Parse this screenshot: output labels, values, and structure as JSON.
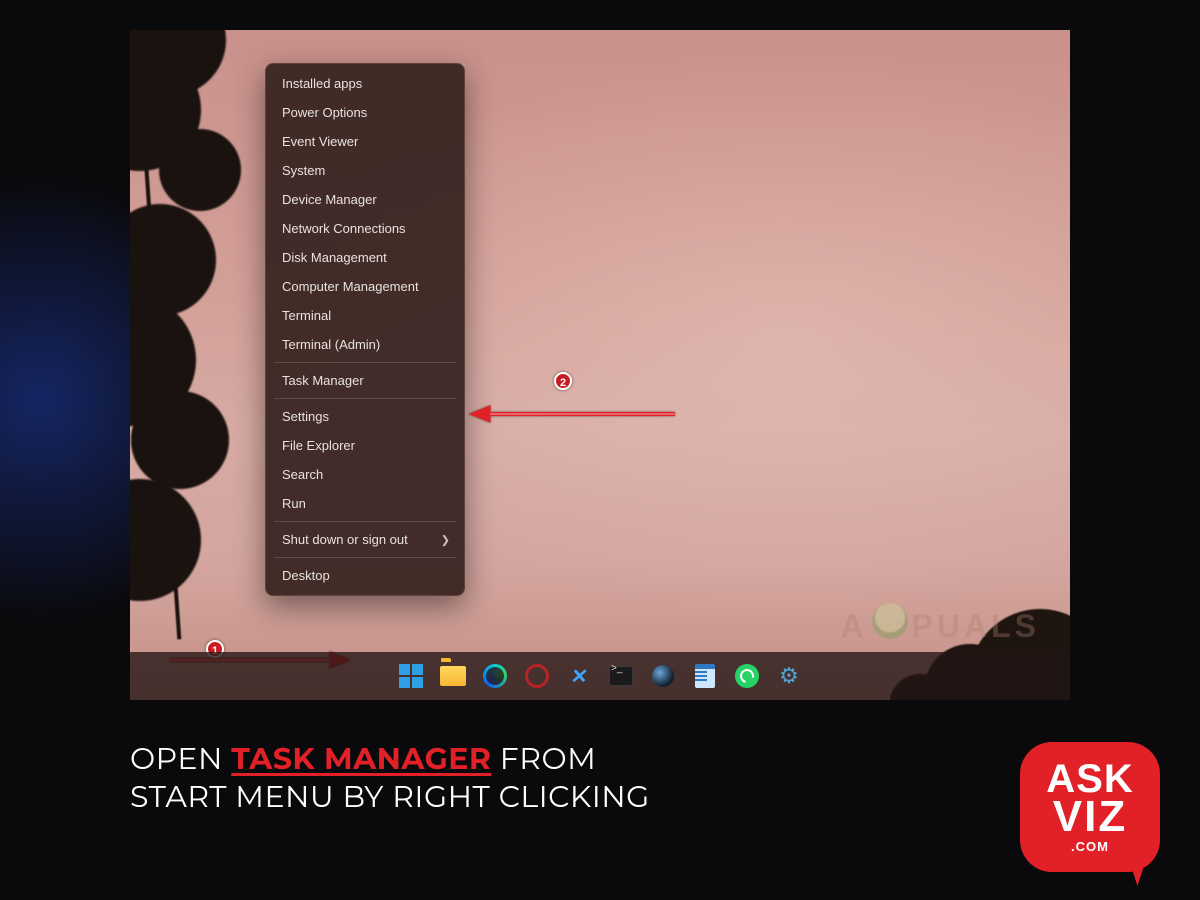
{
  "context_menu": {
    "items": [
      "Installed apps",
      "Power Options",
      "Event Viewer",
      "System",
      "Device Manager",
      "Network Connections",
      "Disk Management",
      "Computer Management",
      "Terminal",
      "Terminal (Admin)"
    ],
    "items2": [
      "Task Manager"
    ],
    "items3": [
      "Settings",
      "File Explorer",
      "Search",
      "Run"
    ],
    "items4": [
      "Shut down or sign out"
    ],
    "items5": [
      "Desktop"
    ]
  },
  "annotations": {
    "step1": "1",
    "step2": "2"
  },
  "taskbar": {
    "icons": [
      {
        "name": "start-button"
      },
      {
        "name": "file-explorer-icon"
      },
      {
        "name": "edge-icon"
      },
      {
        "name": "opera-icon"
      },
      {
        "name": "vscode-icon"
      },
      {
        "name": "terminal-icon"
      },
      {
        "name": "steam-icon"
      },
      {
        "name": "notepad-icon"
      },
      {
        "name": "whatsapp-icon"
      },
      {
        "name": "settings-icon"
      }
    ]
  },
  "watermark": {
    "left": "A",
    "right": "PUALS"
  },
  "caption": {
    "pre": "OPEN ",
    "highlight": "TASK MANAGER",
    "post1": " FROM",
    "line2": "START MENU BY RIGHT CLICKING"
  },
  "logo": {
    "line1": "ASK",
    "line2": "VIZ",
    "line3": ".COM"
  }
}
